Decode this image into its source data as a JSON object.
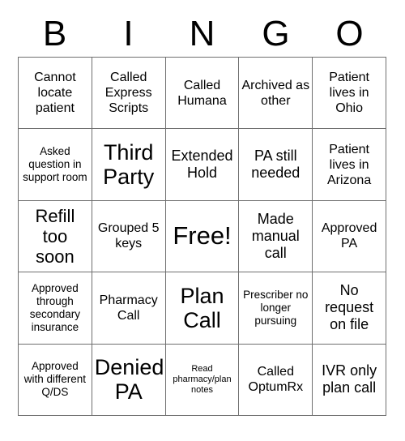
{
  "card": {
    "title": "BINGO",
    "header_letters": [
      "B",
      "I",
      "N",
      "G",
      "O"
    ],
    "grid_size": 5,
    "free_space": {
      "row": 2,
      "column": 2,
      "label": "Free!"
    },
    "colors": {
      "background": "#ffffff",
      "text": "#000000",
      "border": "#6f6f6f"
    },
    "rows": [
      [
        {
          "text": "Cannot locate patient",
          "size": "md"
        },
        {
          "text": "Called Express Scripts",
          "size": "md"
        },
        {
          "text": "Called Humana",
          "size": "md"
        },
        {
          "text": "Archived as other",
          "size": "md"
        },
        {
          "text": "Patient lives in Ohio",
          "size": "md"
        }
      ],
      [
        {
          "text": "Asked question in support room",
          "size": "sm"
        },
        {
          "text": "Third Party",
          "size": "xxl"
        },
        {
          "text": "Extended Hold",
          "size": "lg"
        },
        {
          "text": "PA still needed",
          "size": "lg"
        },
        {
          "text": "Patient lives in Arizona",
          "size": "md"
        }
      ],
      [
        {
          "text": "Refill too soon",
          "size": "xl"
        },
        {
          "text": "Grouped 5 keys",
          "size": "md"
        },
        {
          "text": "Free!",
          "size": "free"
        },
        {
          "text": "Made manual call",
          "size": "lg"
        },
        {
          "text": "Approved PA",
          "size": "md"
        }
      ],
      [
        {
          "text": "Approved through secondary insurance",
          "size": "sm"
        },
        {
          "text": "Pharmacy Call",
          "size": "md"
        },
        {
          "text": "Plan Call",
          "size": "xxl"
        },
        {
          "text": "Prescriber no longer pursuing",
          "size": "sm"
        },
        {
          "text": "No request on file",
          "size": "lg"
        }
      ],
      [
        {
          "text": "Approved with different Q/DS",
          "size": "sm"
        },
        {
          "text": "Denied PA",
          "size": "xxl"
        },
        {
          "text": "Read pharmacy/plan notes",
          "size": "xs"
        },
        {
          "text": "Called OptumRx",
          "size": "md"
        },
        {
          "text": "IVR only plan call",
          "size": "lg"
        }
      ]
    ]
  }
}
